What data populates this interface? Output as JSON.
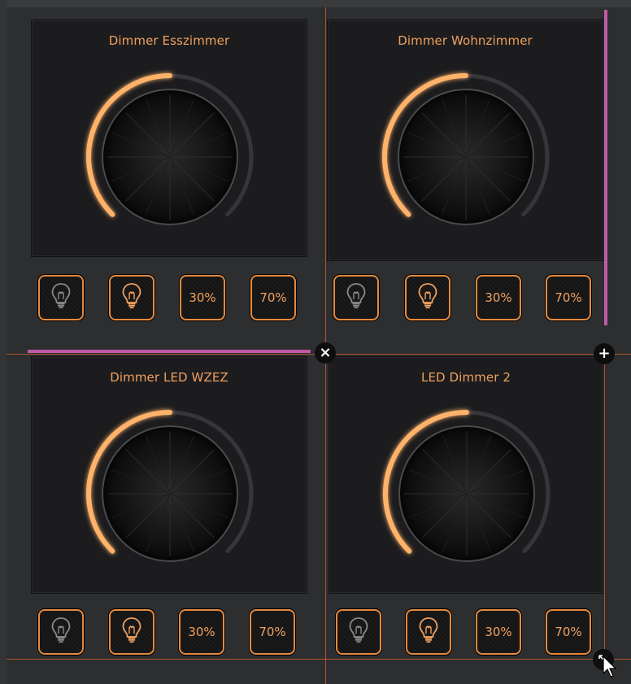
{
  "colors": {
    "accent": "#e58a3e",
    "title": "#f0a05e",
    "grid": "#b0532e",
    "selection": "#c15aa6",
    "panel": "#1c1c1e",
    "background": "#2d2e30"
  },
  "tiles": [
    {
      "title": "Dimmer Esszimmer",
      "level_fraction": 0.5,
      "buttons": [
        {
          "icon": "bulb-off-icon"
        },
        {
          "icon": "bulb-on-icon"
        },
        {
          "label": "30%"
        },
        {
          "label": "70%"
        }
      ]
    },
    {
      "title": "Dimmer Wohnzimmer",
      "level_fraction": 0.5,
      "buttons": [
        {
          "icon": "bulb-off-icon"
        },
        {
          "icon": "bulb-on-icon"
        },
        {
          "label": "30%"
        },
        {
          "label": "70%"
        }
      ]
    },
    {
      "title": "Dimmer LED WZEZ",
      "level_fraction": 0.5,
      "buttons": [
        {
          "icon": "bulb-off-icon"
        },
        {
          "icon": "bulb-on-icon"
        },
        {
          "label": "30%"
        },
        {
          "label": "70%"
        }
      ]
    },
    {
      "title": "LED Dimmer 2",
      "level_fraction": 0.5,
      "buttons": [
        {
          "icon": "bulb-off-icon"
        },
        {
          "icon": "bulb-on-icon"
        },
        {
          "label": "30%"
        },
        {
          "label": "70%"
        }
      ]
    }
  ],
  "controls": {
    "remove_label": "×",
    "add_label": "+",
    "resize_icon": "resize-arrows-icon"
  }
}
